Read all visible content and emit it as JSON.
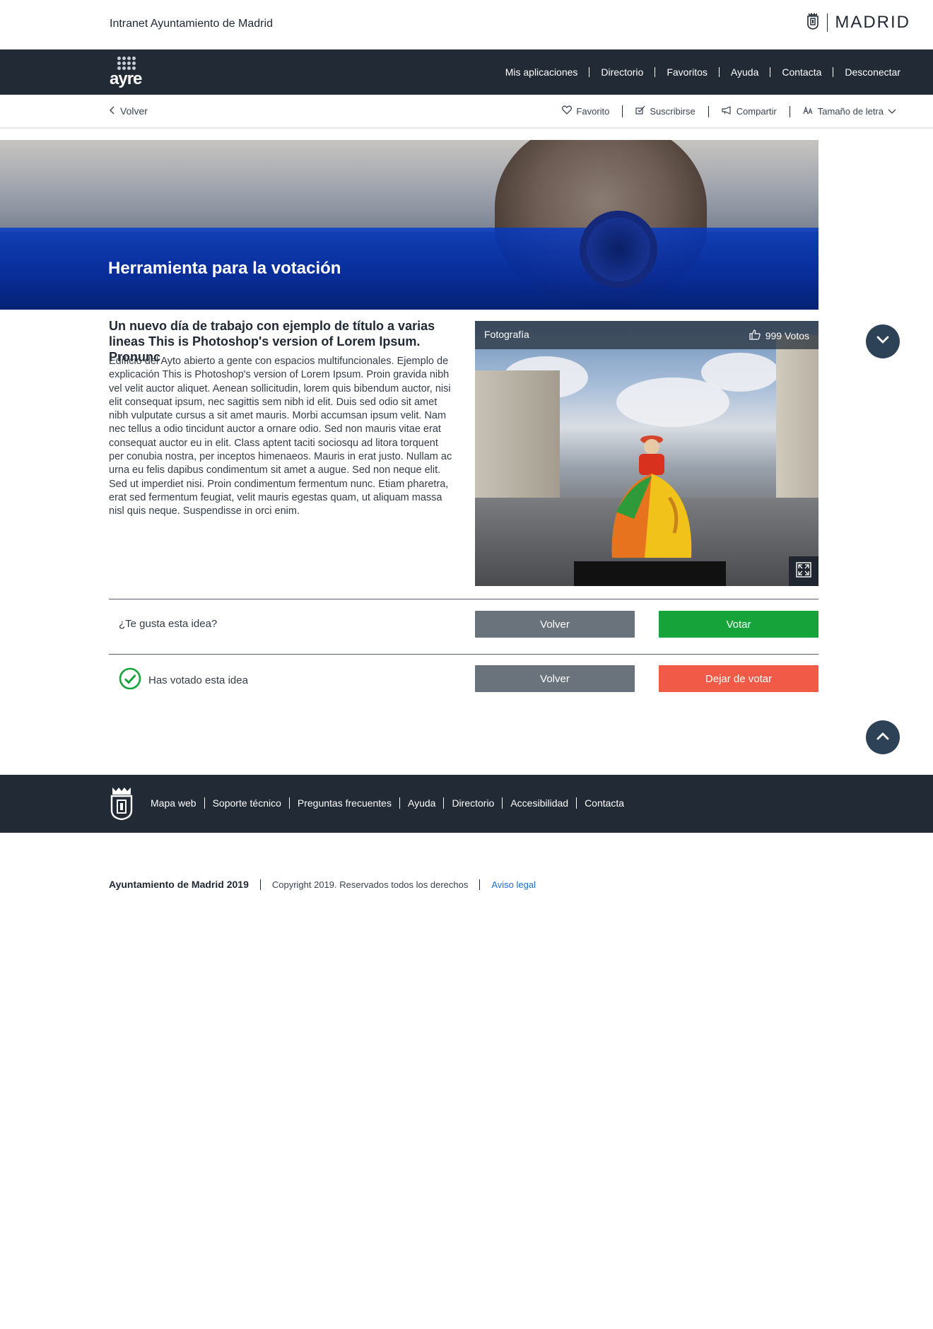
{
  "header": {
    "site_title": "Intranet Ayuntamiento de Madrid",
    "brand": "MADRID"
  },
  "navbar": {
    "logo_text": "ayre",
    "menu": [
      "Mis aplicaciones",
      "Directorio",
      "Favoritos",
      "Ayuda",
      "Contacta",
      "Desconectar"
    ]
  },
  "subbar": {
    "back_label": "Volver",
    "actions": {
      "favorito": "Favorito",
      "suscribirse": "Suscribirse",
      "compartir": "Compartir",
      "tamano": "Tamaño de letra"
    }
  },
  "hero": {
    "title": "Herramienta para la votación"
  },
  "article": {
    "title": "Un nuevo día de trabajo con ejemplo de título a varias lineas This is Photoshop's version  of Lorem Ipsum. Pronunc",
    "body": "Edificio del Ayto abierto a gente con espacios multifuncionales. Ejemplo de explicación This is Photoshop's version  of Lorem Ipsum. Proin gravida nibh vel velit auctor aliquet. Aenean sollicitudin, lorem quis bibendum auctor, nisi elit consequat ipsum, nec sagittis sem nibh id elit. Duis sed odio sit amet nibh vulputate cursus a sit amet mauris. Morbi accumsan ipsum velit. Nam nec tellus a odio tincidunt auctor a ornare odio. Sed non mauris vitae erat consequat auctor eu in elit. Class aptent taciti sociosqu ad litora torquent per conubia nostra, per inceptos himenaeos. Mauris in erat justo. Nullam ac urna eu felis dapibus condimentum sit amet a augue. Sed non neque elit. Sed ut imperdiet nisi. Proin condimentum fermentum nunc. Etiam pharetra, erat sed fermentum feugiat, velit mauris egestas quam, ut aliquam massa nisl quis neque. Suspendisse in orci enim."
  },
  "photo": {
    "category": "Fotografía",
    "votes": "999 Votos"
  },
  "vote_prompt": {
    "question": "¿Te gusta esta idea?",
    "back_button": "Volver",
    "vote_button": "Votar"
  },
  "vote_done": {
    "message": "Has votado esta idea",
    "back_button": "Volver",
    "unvote_button": "Dejar de votar"
  },
  "footer": {
    "links": [
      "Mapa web",
      "Soporte técnico",
      "Preguntas frecuentes",
      "Ayuda",
      "Directorio",
      "Accesibilidad",
      "Contacta"
    ]
  },
  "legal": {
    "org": "Ayuntamiento de Madrid 2019",
    "copyright": "Copyright 2019. Reservados todos los derechos",
    "aviso": "Aviso legal"
  },
  "colors": {
    "nav_bg": "#222a35",
    "vote_green": "#16a33a",
    "unvote_red": "#f05a47",
    "neutral_button": "#6a737c",
    "round_button": "#2d4257",
    "link_blue": "#1a6fd6"
  },
  "icons": [
    "madrid-crest-icon",
    "chevron-left-icon",
    "heart-icon",
    "subscribe-icon",
    "megaphone-icon",
    "font-size-icon",
    "chevron-down-icon",
    "thumbs-up-icon",
    "expand-icon",
    "scroll-down-icon",
    "scroll-up-icon",
    "check-circle-icon"
  ]
}
